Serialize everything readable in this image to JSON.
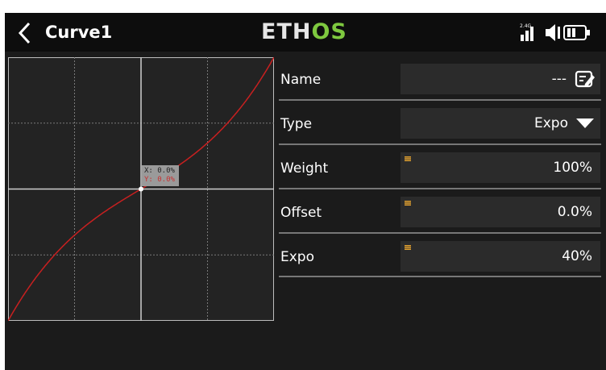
{
  "header": {
    "title": "Curve1",
    "logo_part1": "ETH",
    "logo_part2": "OS",
    "signal_band": "2.4G"
  },
  "graph": {
    "readout_x": "X: 0.0%",
    "readout_y": "Y: 0.0%"
  },
  "fields": {
    "name": {
      "label": "Name",
      "value": "---"
    },
    "type": {
      "label": "Type",
      "value": "Expo"
    },
    "weight": {
      "label": "Weight",
      "value": "100%"
    },
    "offset": {
      "label": "Offset",
      "value": "0.0%"
    },
    "expo": {
      "label": "Expo",
      "value": "40%"
    }
  },
  "colors": {
    "curve": "#c82020",
    "accent_green": "#7ec83f",
    "marker_orange": "#e0a030"
  }
}
